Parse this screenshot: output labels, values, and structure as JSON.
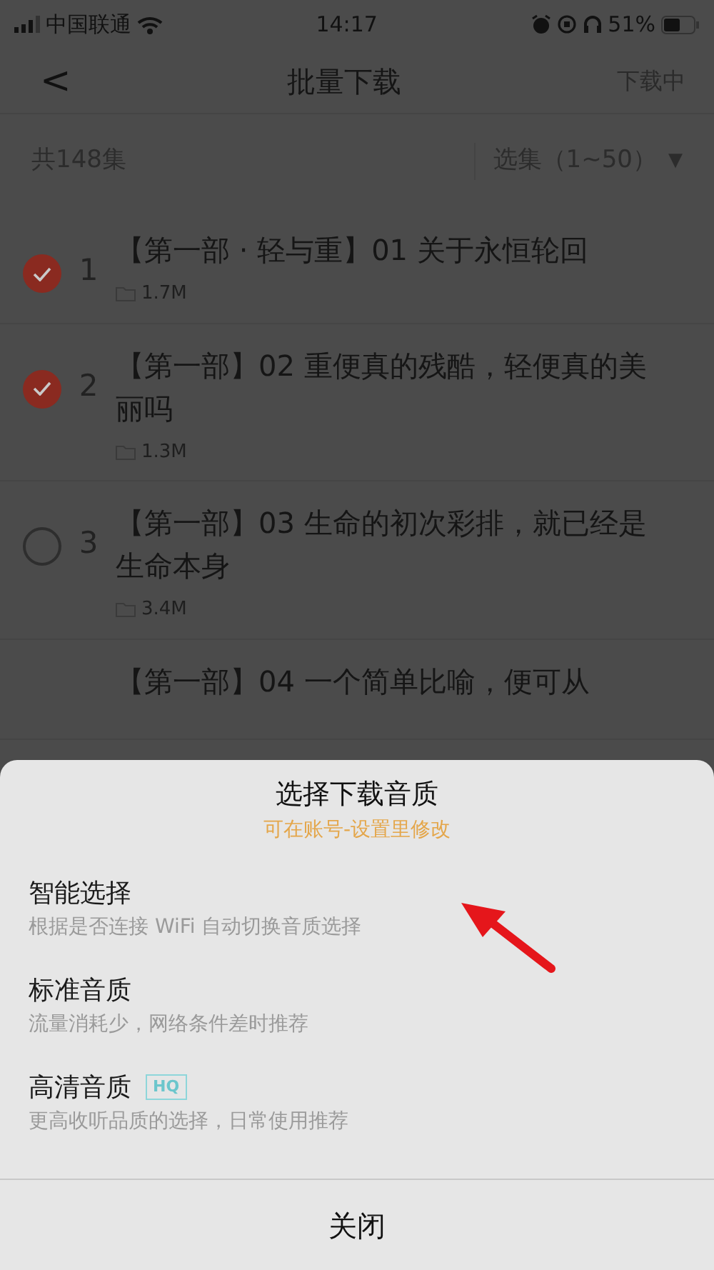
{
  "status_bar": {
    "carrier": "中国联通",
    "time": "14:17",
    "battery": "51%"
  },
  "nav": {
    "back": "<",
    "title": "批量下载",
    "action": "下载中"
  },
  "summary": {
    "count": "共148集",
    "range": "选集（1~50）",
    "range_caret": "▼"
  },
  "episodes": [
    {
      "index": "1",
      "title": "【第一部 · 轻与重】01 关于永恒轮回",
      "size": "1.7M",
      "checked": true
    },
    {
      "index": "2",
      "title": "【第一部】02 重便真的残酷，轻便真的美丽吗",
      "size": "1.3M",
      "checked": true
    },
    {
      "index": "3",
      "title": "【第一部】03 生命的初次彩排，就已经是生命本身",
      "size": "3.4M",
      "checked": false
    },
    {
      "title": "【第一部】04 一个简单比喻，便可从"
    }
  ],
  "sheet": {
    "title": "选择下载音质",
    "subtitle": "可在账号-设置里修改",
    "options": [
      {
        "name": "智能选择",
        "description": "根据是否连接 WiFi 自动切换音质选择"
      },
      {
        "name": "标准音质",
        "description": "流量消耗少，网络条件差时推荐"
      },
      {
        "name": "高清音质",
        "badge": "HQ",
        "description": "更高收听品质的选择，日常使用推荐"
      }
    ],
    "close": "关闭"
  }
}
